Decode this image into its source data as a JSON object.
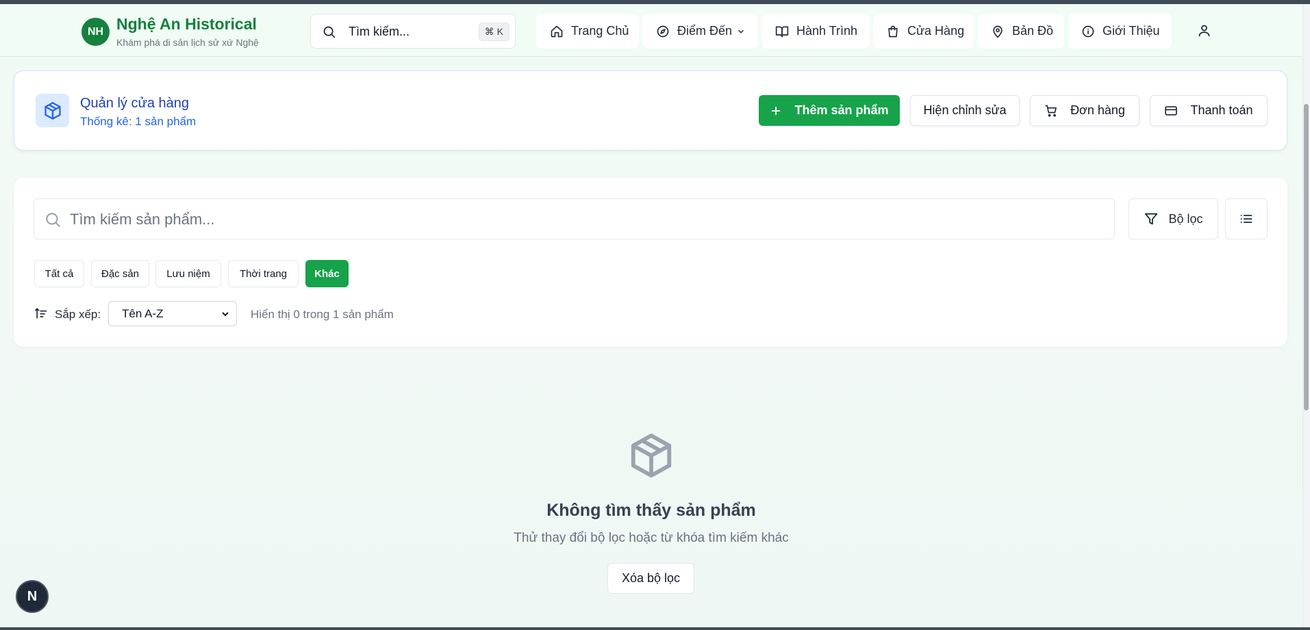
{
  "header": {
    "logo_initials": "NH",
    "brand_title": "Nghệ An Historical",
    "brand_subtitle": "Khám phá di sản lịch sử xứ Nghệ",
    "search_placeholder": "Tìm kiếm...",
    "search_shortcut": "⌘ K",
    "nav": [
      {
        "label": "Trang Chủ",
        "icon": "home-icon"
      },
      {
        "label": "Điểm Đến",
        "icon": "compass-icon"
      },
      {
        "label": "Hành Trình",
        "icon": "book-open-icon"
      },
      {
        "label": "Cửa Hàng",
        "icon": "shopping-bag-icon"
      },
      {
        "label": "Bản Đồ",
        "icon": "map-pin-icon"
      },
      {
        "label": "Giới Thiệu",
        "icon": "info-icon"
      }
    ]
  },
  "store": {
    "title": "Quản lý cửa hàng",
    "stats": "Thống kê: 1 sản phẩm",
    "add_product": "Thêm sản phẩm",
    "show_edit": "Hiện chỉnh sửa",
    "orders": "Đơn hàng",
    "payment": "Thanh toán"
  },
  "filters": {
    "search_placeholder": "Tìm kiếm sản phẩm...",
    "filter_button": "Bộ lọc",
    "categories": [
      "Tất cả",
      "Đặc sản",
      "Lưu niệm",
      "Thời trang",
      "Khác"
    ],
    "active_category": "Khác",
    "sort_label": "Sắp xếp:",
    "sort_value": "Tên A-Z",
    "showing_text": "Hiển thị 0 trong 1 sản phẩm"
  },
  "empty_state": {
    "title": "Không tìm thấy sản phẩm",
    "subtitle": "Thử thay đổi bộ lọc hoặc từ khóa tìm kiếm khác",
    "clear_button": "Xóa bộ lọc"
  },
  "dev_badge": "N",
  "colors": {
    "brand_green": "#16813e",
    "primary_green": "#16a34a",
    "store_blue": "#1e40af"
  }
}
